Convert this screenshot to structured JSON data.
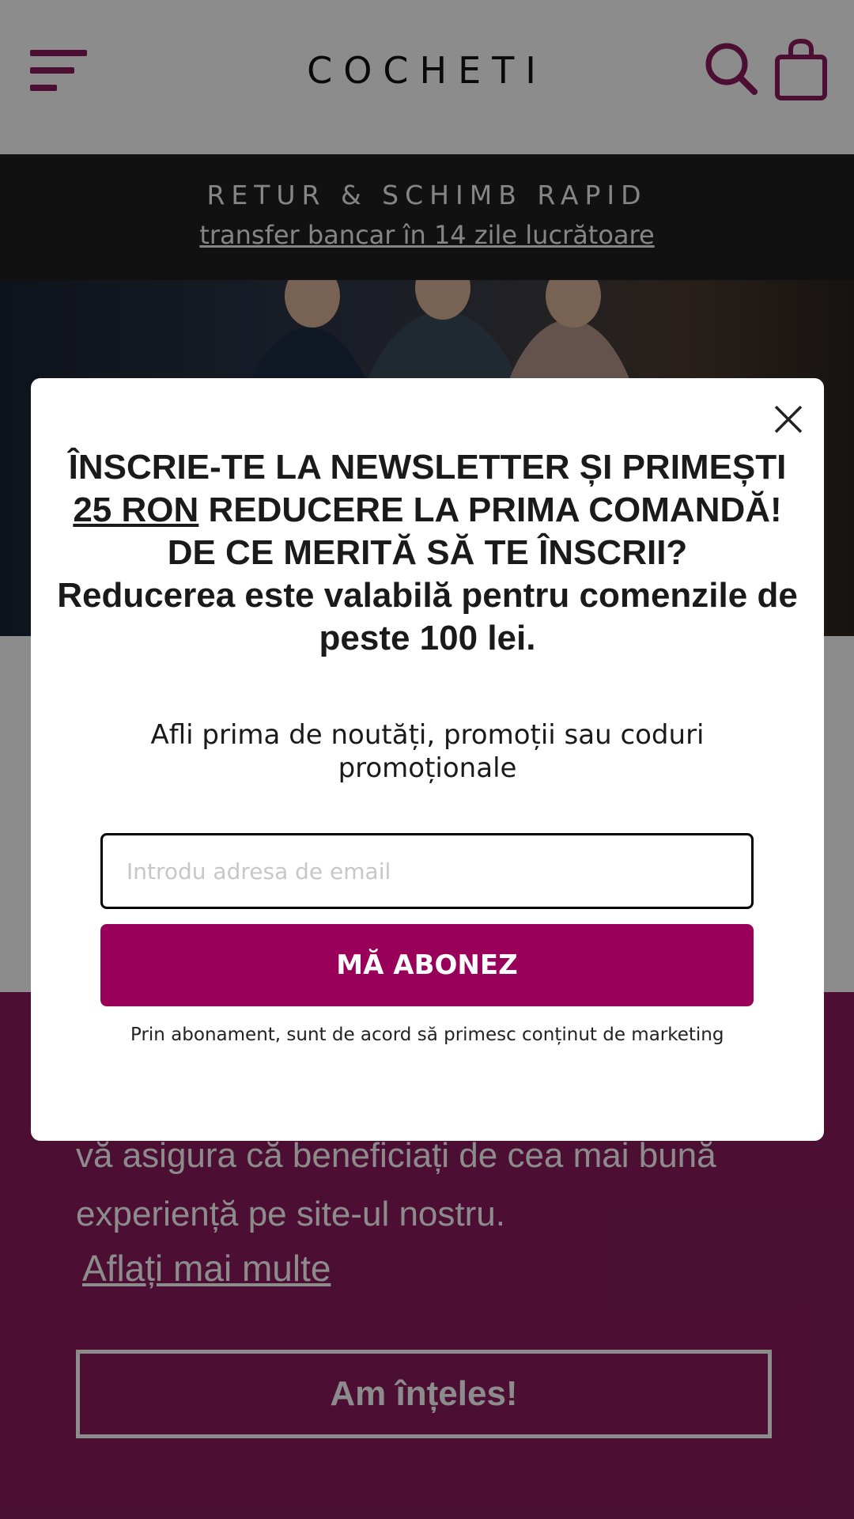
{
  "header": {
    "logo": "COCHETI",
    "menu_icon": "hamburger-menu-icon",
    "search_icon": "search-icon",
    "cart_icon": "shopping-bag-icon",
    "accent_color": "#8a1d5d"
  },
  "announcement": {
    "title": "RETUR & SCHIMB RAPID",
    "link": "transfer bancar în 14 zile lucrătoare"
  },
  "cookie": {
    "text": "vă asigura că beneficiați de cea mai bună experiență pe site-ul nostru.",
    "link": "Aflați mai multe",
    "button": "Am înțeles!",
    "background_color": "#8a1d5d"
  },
  "modal": {
    "close_icon": "close-icon",
    "heading_part1": "ÎNSCRIE-TE LA NEWSLETTER ȘI PRIMEȘTI ",
    "heading_highlight": "25 RON",
    "heading_part2": " REDUCERE LA PRIMA COMANDĂ!",
    "heading_line2": "DE CE MERITĂ SĂ TE ÎNSCRII?",
    "heading_line3": "Reducerea este valabilă pentru comenzile de peste 100 lei.",
    "subtext": "Afli prima de noutăți, promoții sau coduri promoționale",
    "email_placeholder": "Introdu adresa de email",
    "email_value": "",
    "subscribe_button": "MĂ ABONEZ",
    "consent": "Prin abonament, sunt de acord să primesc conținut de marketing",
    "button_color": "#98005a"
  }
}
